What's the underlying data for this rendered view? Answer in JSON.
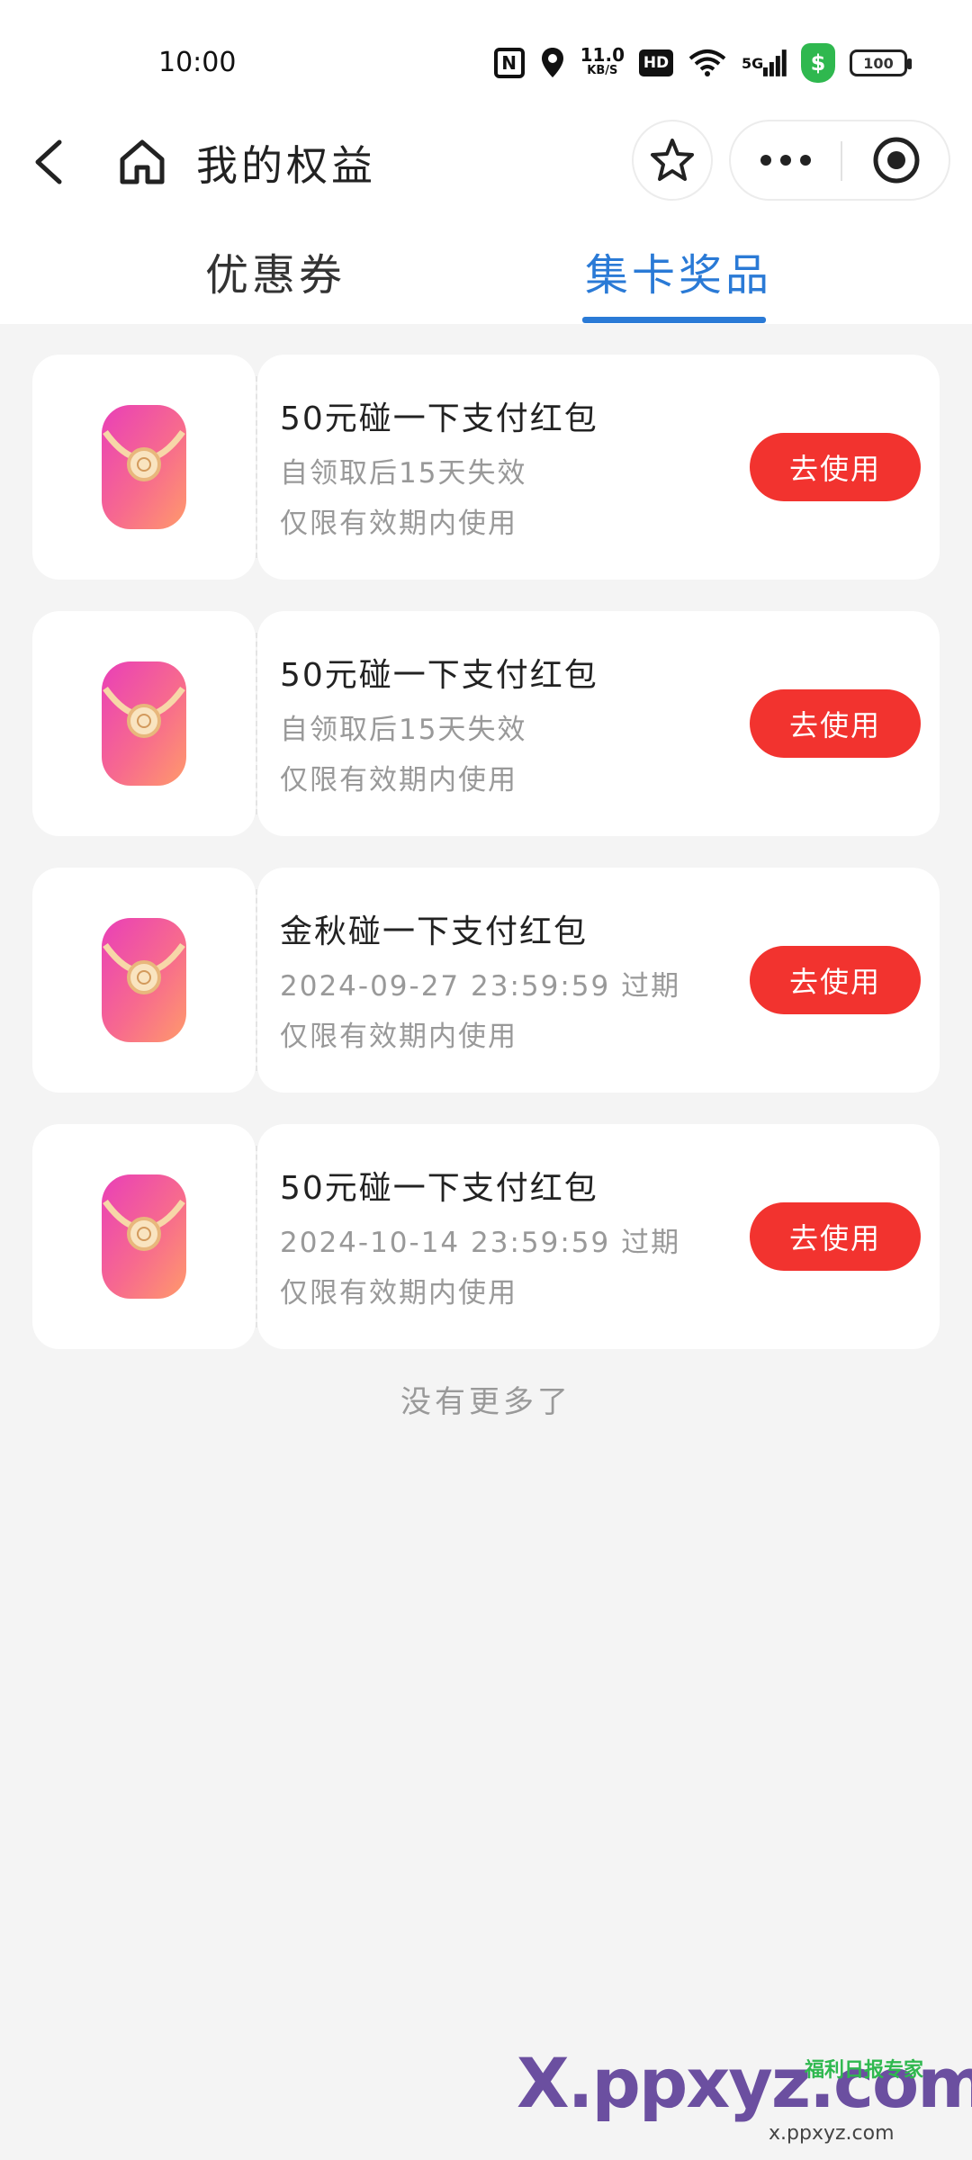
{
  "status_bar": {
    "time": "10:00",
    "nfc": "N",
    "speed_value": "11.0",
    "speed_unit": "KB/S",
    "hd": "HD",
    "network": "5G",
    "shield_symbol": "$",
    "battery": "100"
  },
  "nav": {
    "title": "我的权益"
  },
  "tabs": [
    {
      "label": "优惠券",
      "active": false
    },
    {
      "label": "集卡奖品",
      "active": true
    }
  ],
  "cards": [
    {
      "title": "50元碰一下支付红包",
      "expiry": "自领取后15天失效",
      "note": "仅限有效期内使用",
      "button": "去使用"
    },
    {
      "title": "50元碰一下支付红包",
      "expiry": "自领取后15天失效",
      "note": "仅限有效期内使用",
      "button": "去使用"
    },
    {
      "title": "金秋碰一下支付红包",
      "expiry": "2024-09-27  23:59:59  过期",
      "note": "仅限有效期内使用",
      "button": "去使用"
    },
    {
      "title": "50元碰一下支付红包",
      "expiry": "2024-10-14  23:59:59  过期",
      "note": "仅限有效期内使用",
      "button": "去使用"
    }
  ],
  "footer": {
    "no_more": "没有更多了"
  },
  "watermark": {
    "text": "X.ppxyz.com",
    "sub": "x.ppxyz.com",
    "badge": "福利日报专家"
  },
  "colors": {
    "accent_blue": "#2a7ad6",
    "button_red": "#f2332f",
    "background": "#f4f4f4"
  },
  "icons": {
    "back": "chevron-left-icon",
    "home": "home-icon",
    "favorite": "star-icon",
    "more": "more-dots-icon",
    "close": "target-circle-icon",
    "red_packet": "red-packet-icon"
  }
}
